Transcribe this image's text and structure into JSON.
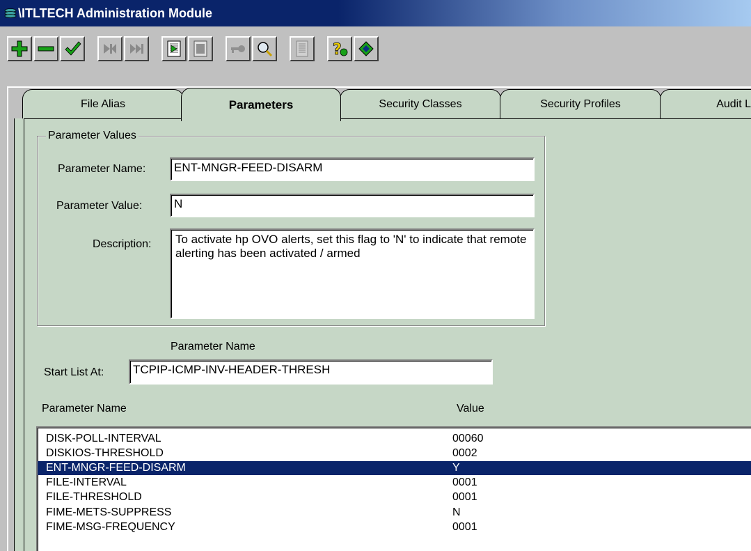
{
  "window": {
    "title": "\\ITLTECH Administration Module"
  },
  "toolbar": {
    "buttons": [
      {
        "name": "add-button",
        "icon": "plus-icon"
      },
      {
        "name": "delete-button",
        "icon": "minus-icon"
      },
      {
        "name": "confirm-button",
        "icon": "check-icon"
      },
      {
        "name": "first-record-button",
        "icon": "skip-first-icon"
      },
      {
        "name": "next-record-button",
        "icon": "skip-next-icon"
      },
      {
        "name": "export-button",
        "icon": "document-arrow-icon"
      },
      {
        "name": "print-button",
        "icon": "document-gray-icon"
      },
      {
        "name": "key-button",
        "icon": "key-icon"
      },
      {
        "name": "find-button",
        "icon": "magnifier-icon"
      },
      {
        "name": "report-button",
        "icon": "page-gray-icon"
      },
      {
        "name": "help-button",
        "icon": "help-icon"
      },
      {
        "name": "exit-button",
        "icon": "exit-icon"
      }
    ]
  },
  "tabs": [
    {
      "label": "File Alias",
      "active": false
    },
    {
      "label": "Parameters",
      "active": true
    },
    {
      "label": "Security Classes",
      "active": false
    },
    {
      "label": "Security Profiles",
      "active": false
    },
    {
      "label": "Audit L",
      "active": false
    }
  ],
  "form": {
    "group_title": "Parameter Values",
    "name_label": "Parameter Name:",
    "name_value": "ENT-MNGR-FEED-DISARM",
    "value_label": "Parameter Value:",
    "value_value": "N",
    "description_label": "Description:",
    "description_value": "To activate hp OVO alerts, set this flag to 'N' to indicate that remote alerting has been activated / armed"
  },
  "start_list": {
    "column_caption": "Parameter Name",
    "label": "Start List At:",
    "value": "TCPIP-ICMP-INV-HEADER-THRESH"
  },
  "list": {
    "headers": {
      "name": "Parameter Name",
      "value": "Value"
    },
    "rows": [
      {
        "name": "DISK-POLL-INTERVAL",
        "value": "00060",
        "selected": false
      },
      {
        "name": "DISKIOS-THRESHOLD",
        "value": "0002",
        "selected": false
      },
      {
        "name": "ENT-MNGR-FEED-DISARM",
        "value": "Y",
        "selected": true
      },
      {
        "name": "FILE-INTERVAL",
        "value": "0001",
        "selected": false
      },
      {
        "name": "FILE-THRESHOLD",
        "value": "0001",
        "selected": false
      },
      {
        "name": "FIME-METS-SUPPRESS",
        "value": "N",
        "selected": false
      },
      {
        "name": "FIME-MSG-FREQUENCY",
        "value": "0001",
        "selected": false
      }
    ]
  },
  "colors": {
    "selection": "#0a246a",
    "panel": "#c6d7c6",
    "titlebar": "#0a246a"
  }
}
